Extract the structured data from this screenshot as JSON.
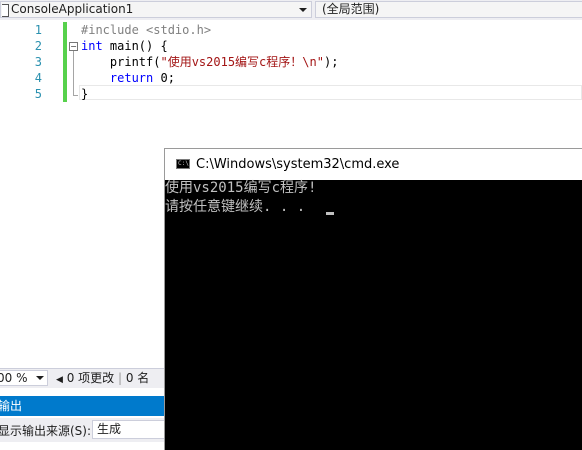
{
  "topbar": {
    "project_dropdown": "ConsoleApplication1",
    "scope_dropdown": "(全局范围)"
  },
  "editor": {
    "line_numbers": [
      "1",
      "2",
      "3",
      "4",
      "5"
    ],
    "lines": {
      "l1": "#include <stdio.h>",
      "l2_kw": "int",
      "l2_rest": " main() {",
      "l3_fn": "    printf(",
      "l3_str": "\"使用vs2015编写c程序！\\n\"",
      "l3_end": ");",
      "l4_kw": "    return",
      "l4_rest": " 0;",
      "l5": "}"
    },
    "outline_symbol": "−"
  },
  "statusbar": {
    "zoom": "00 %",
    "changes_arrow": "◀",
    "changes_text": " 0 项更改",
    "changes_sep": " | ",
    "changes_rest": "0 名"
  },
  "output": {
    "title": "输出",
    "source_label": "显示输出来源(S):",
    "source_value": "生成"
  },
  "cmd": {
    "title": "C:\\Windows\\system32\\cmd.exe",
    "icon_text": "C:\\",
    "console_lines": [
      "使用vs2015编写c程序!",
      "请按任意键继续. . ."
    ]
  },
  "colors": {
    "accent": "#007acc",
    "change_bar": "#57d14c",
    "line_number": "#2b91af",
    "keyword": "#0000ff",
    "string": "#a31515",
    "console_bg": "#000000",
    "console_text": "#c0c0c0"
  }
}
